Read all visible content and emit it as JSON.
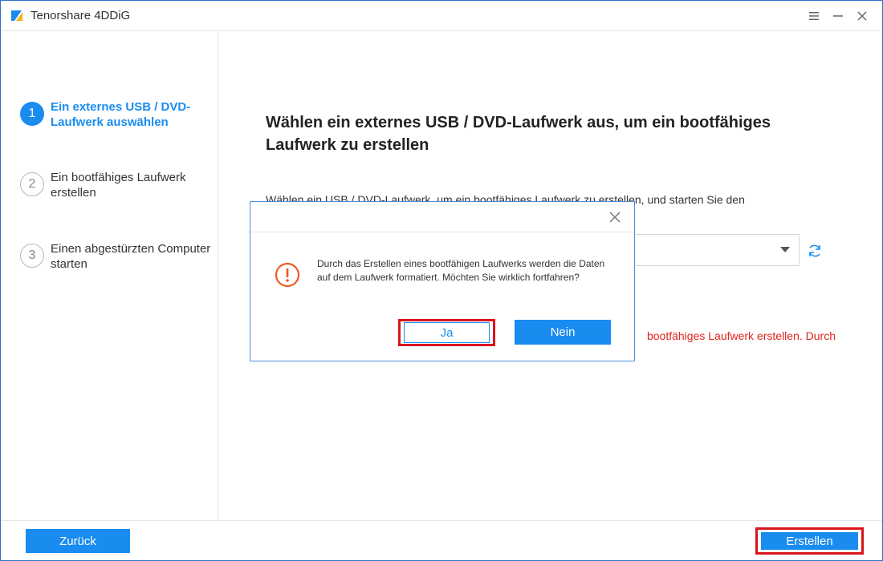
{
  "app": {
    "title": "Tenorshare 4DDiG"
  },
  "window_controls": {
    "menu_icon": "menu-icon",
    "minimize_icon": "minimize-icon",
    "close_icon": "close-icon"
  },
  "sidebar": {
    "steps": [
      {
        "number": "1",
        "label": "Ein externes USB / DVD-Laufwerk auswählen",
        "active": true
      },
      {
        "number": "2",
        "label": "Ein bootfähiges Laufwerk erstellen",
        "active": false
      },
      {
        "number": "3",
        "label": "Einen abgestürzten Computer starten",
        "active": false
      }
    ]
  },
  "main": {
    "title": "Wählen ein externes USB / DVD-Laufwerk aus, um ein bootfähiges Laufwerk zu erstellen",
    "description": "Wählen ein USB / DVD-Laufwerk, um ein bootfähiges Laufwerk zu erstellen, und starten Sie den",
    "warning": "bootfähiges Laufwerk erstellen. Durch"
  },
  "footer": {
    "back_label": "Zurück",
    "create_label": "Erstellen"
  },
  "dialog": {
    "message": "Durch das Erstellen eines bootfähigen Laufwerks werden die Daten auf dem Laufwerk formatiert. Möchten Sie wirklich fortfahren?",
    "yes_label": "Ja",
    "no_label": "Nein"
  },
  "colors": {
    "accent": "#1a8cf0",
    "warning": "#e0241b",
    "dialog_icon": "#f05a24",
    "highlight": "#d9141e"
  }
}
